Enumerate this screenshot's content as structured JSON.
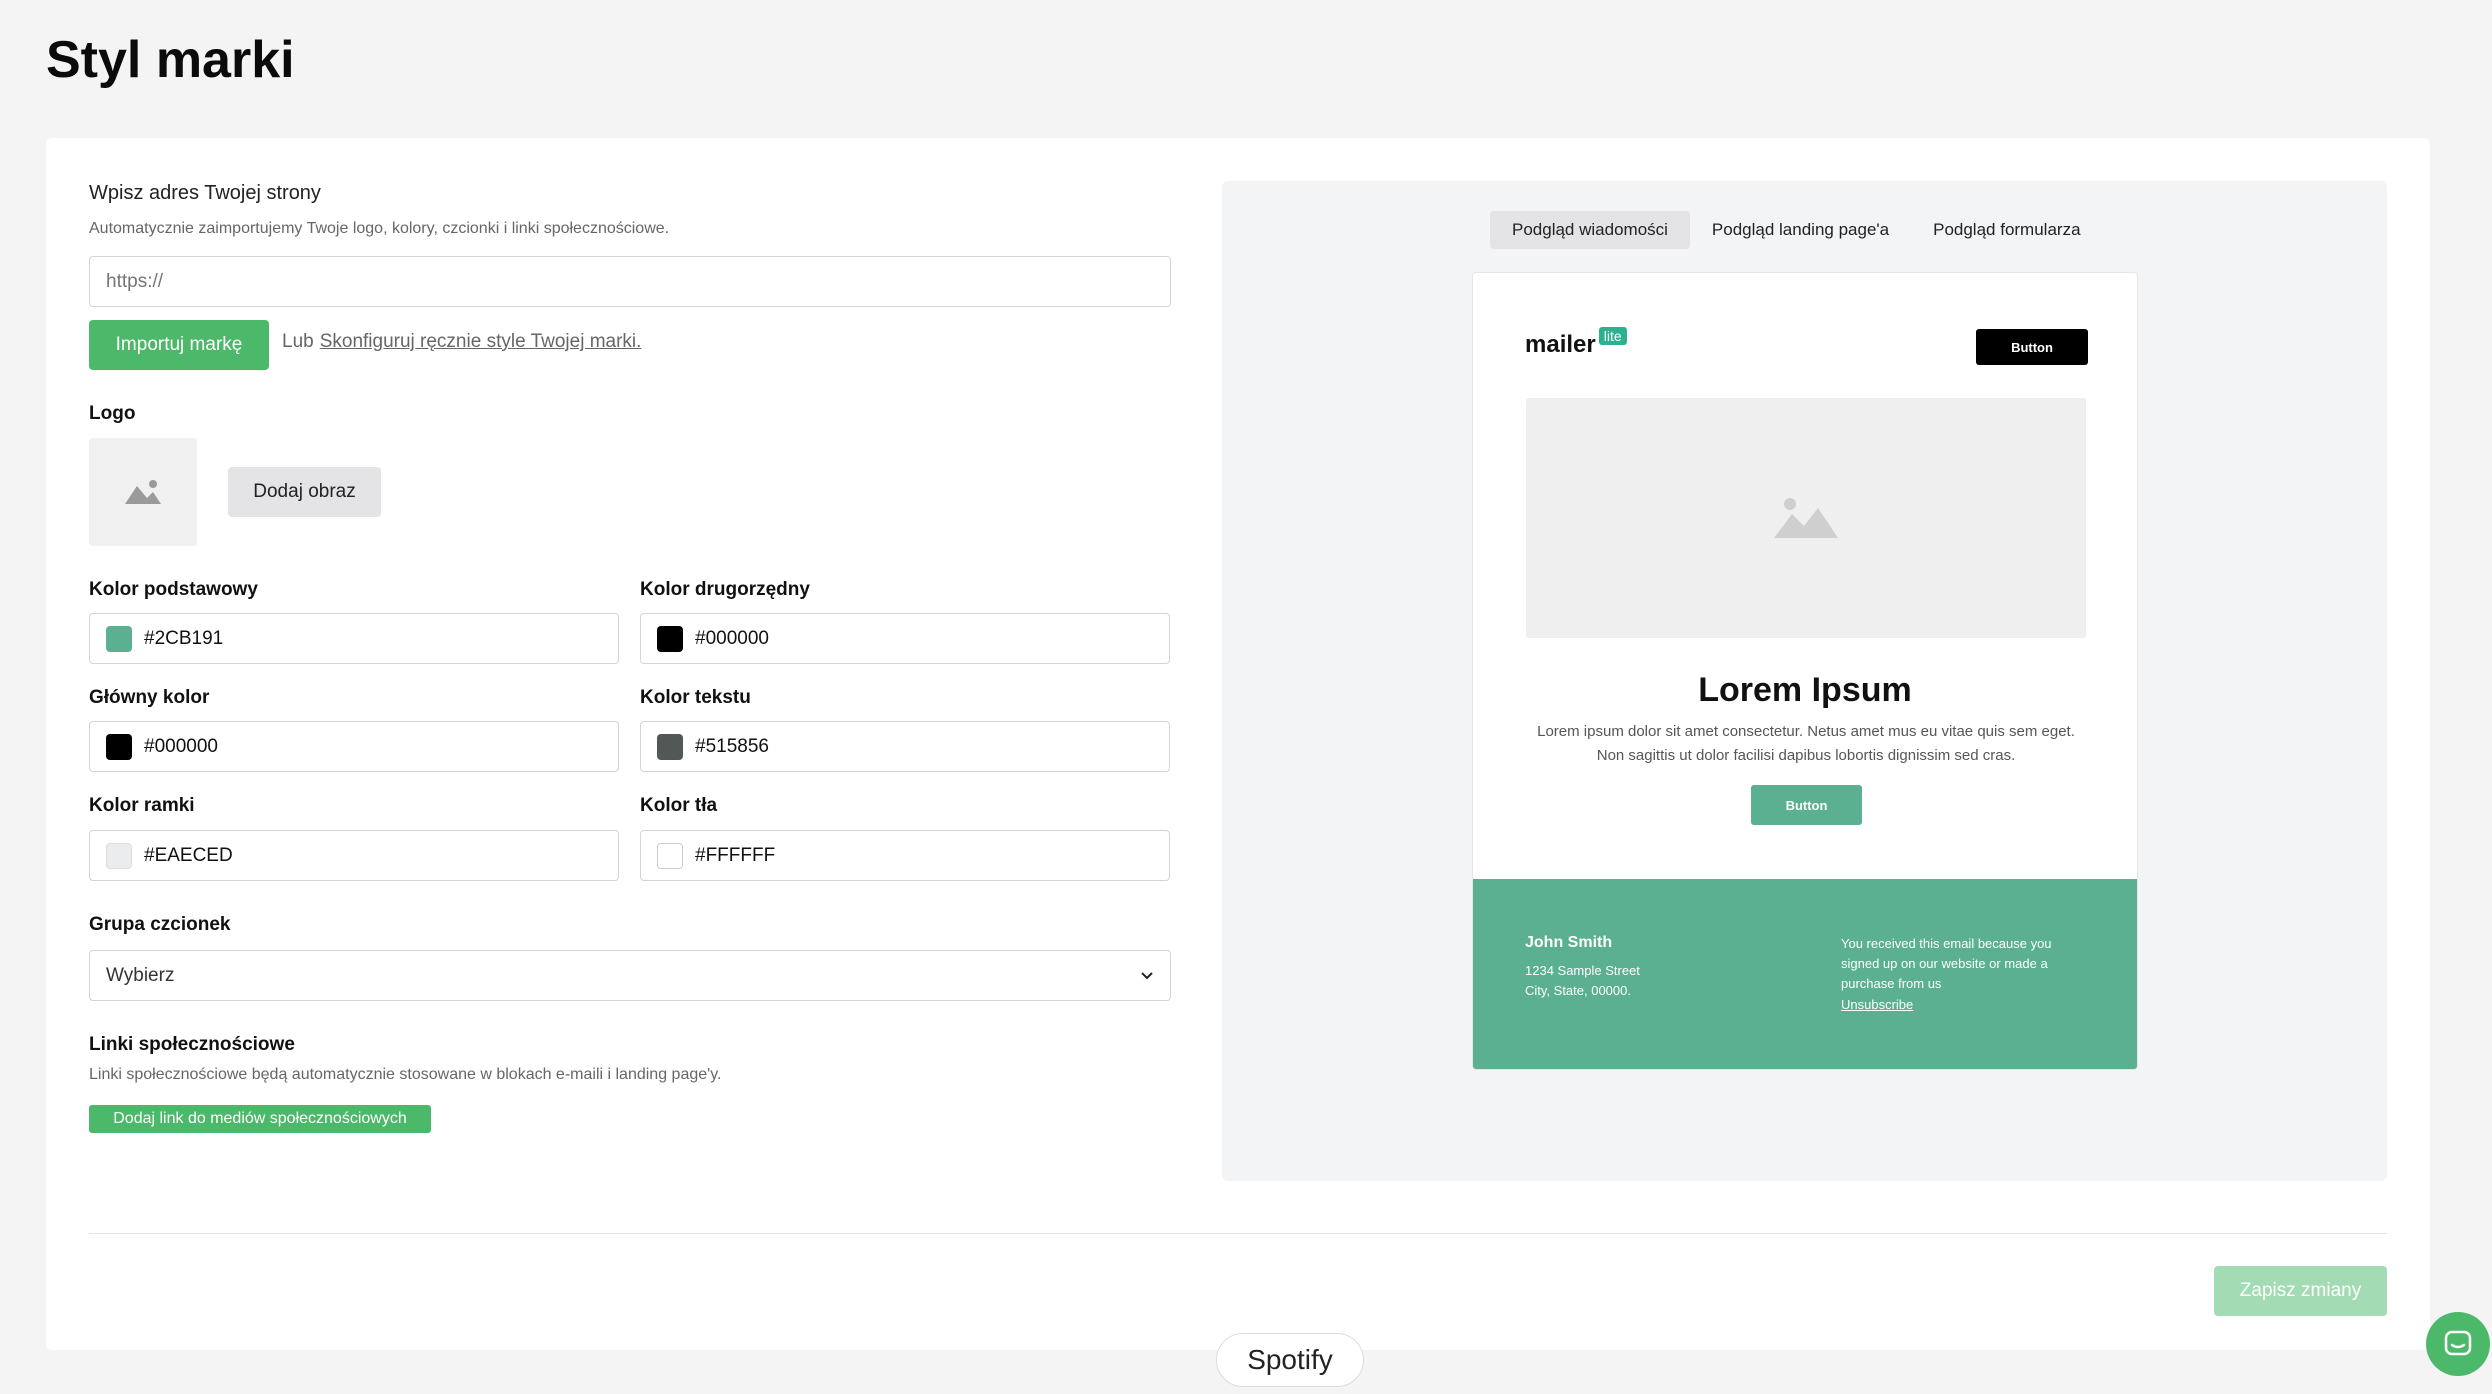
{
  "page": {
    "title": "Styl marki"
  },
  "website": {
    "label": "Wpisz adres Twojej strony",
    "help": "Automatycznie zaimportujemy Twoje logo, kolory, czcionki i linki społecznościowe.",
    "placeholder": "https://",
    "import_button": "Importuj markę",
    "or_text": "Lub",
    "manual_link": "Skonfiguruj ręcznie style Twojej marki."
  },
  "logo": {
    "label": "Logo",
    "add_image_button": "Dodaj obraz",
    "icon": "image-placeholder-icon"
  },
  "colors": {
    "primary": {
      "label": "Kolor podstawowy",
      "value": "#2CB191",
      "swatch": "#5ab091"
    },
    "secondary": {
      "label": "Kolor drugorzędny",
      "value": "#000000",
      "swatch": "#000000"
    },
    "main": {
      "label": "Główny kolor",
      "value": "#000000",
      "swatch": "#000000"
    },
    "text": {
      "label": "Kolor tekstu",
      "value": "#515856",
      "swatch": "#515856"
    },
    "border": {
      "label": "Kolor ramki",
      "value": "#EAECED",
      "swatch": "#EAECED"
    },
    "background": {
      "label": "Kolor tła",
      "value": "#FFFFFF",
      "swatch": "#FFFFFF"
    }
  },
  "fonts": {
    "label": "Grupa czcionek",
    "selected": "Wybierz",
    "icon": "chevron-down-icon"
  },
  "social": {
    "label": "Linki społecznościowe",
    "help": "Linki społecznościowe będą automatycznie stosowane w blokach e-maili i landing page'y.",
    "add_button": "Dodaj link do mediów społecznościowych"
  },
  "actions": {
    "save": "Zapisz zmiany"
  },
  "preview": {
    "tabs": [
      "Podgląd wiadomości",
      "Podgląd landing page'a",
      "Podgląd formularza"
    ],
    "active_tab": 0,
    "email": {
      "brand": "mailer",
      "brand_badge": "lite",
      "top_button": "Button",
      "heading": "Lorem Ipsum",
      "body": "Lorem ipsum dolor sit amet consectetur. Netus amet mus eu vitae quis sem eget. Non sagittis ut dolor facilisi dapibus lobortis dignissim sed cras.",
      "cta_button": "Button",
      "footer": {
        "name": "John Smith",
        "address_line1": "1234 Sample Street",
        "address_line2": "City, State, 00000.",
        "note": "You received this email because you signed up on our website or made a purchase from us",
        "unsubscribe": "Unsubscribe"
      }
    }
  },
  "overlay": {
    "spotify": "Spotify"
  },
  "theme": {
    "accent": "#4cb869",
    "brand": "#2cb191",
    "footer_bg": "#5ab091"
  }
}
